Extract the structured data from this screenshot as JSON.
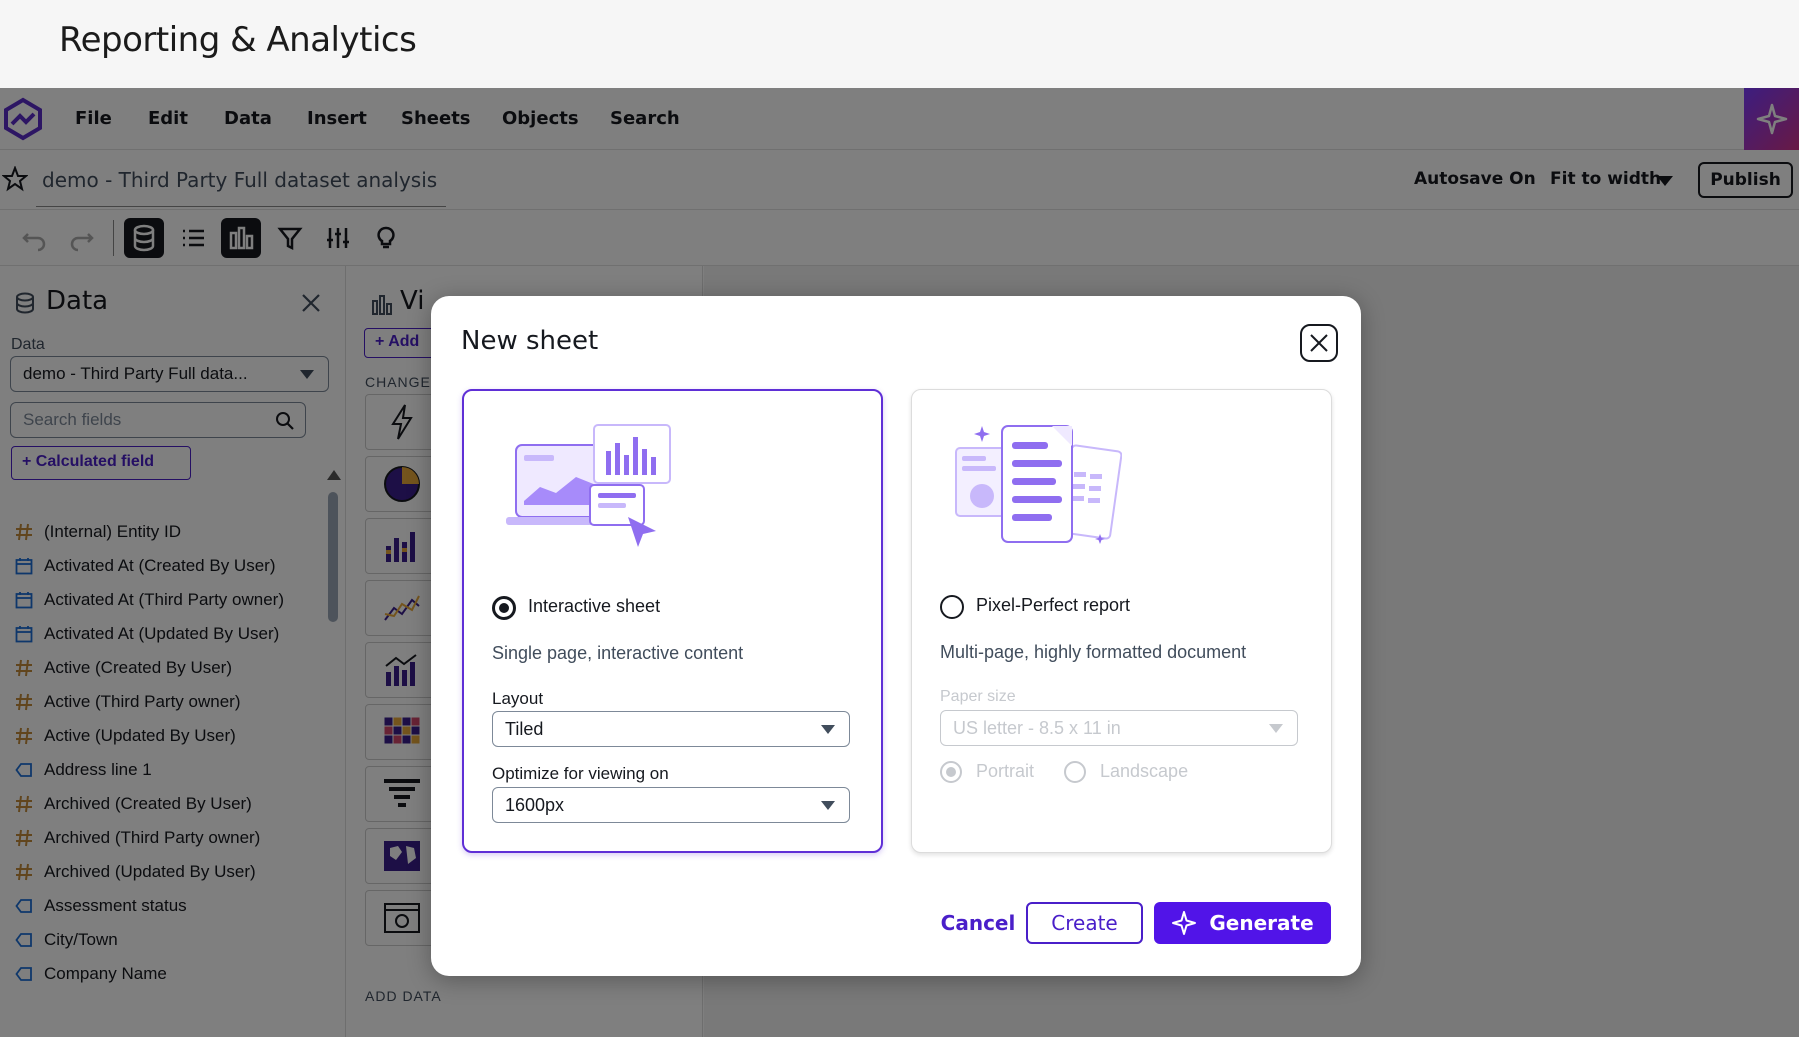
{
  "page": {
    "title": "Reporting & Analytics"
  },
  "menu": {
    "items": [
      "File",
      "Edit",
      "Data",
      "Insert",
      "Sheets",
      "Objects",
      "Search"
    ]
  },
  "titlebar": {
    "doc_title": "demo - Third Party Full dataset analysis",
    "autosave": "Autosave On",
    "fit_to_width": "Fit to width",
    "publish": "Publish"
  },
  "data_panel": {
    "title": "Data",
    "data_label": "Data",
    "dataset": "demo - Third Party Full data...",
    "search_placeholder": "Search fields",
    "calculated_field": "Calculated field",
    "fields": [
      {
        "label": "(Internal) Entity ID",
        "type": "number"
      },
      {
        "label": "Activated At (Created By User)",
        "type": "date"
      },
      {
        "label": "Activated At (Third Party owner)",
        "type": "date"
      },
      {
        "label": "Activated At (Updated By User)",
        "type": "date"
      },
      {
        "label": "Active (Created By User)",
        "type": "number"
      },
      {
        "label": "Active (Third Party owner)",
        "type": "number"
      },
      {
        "label": "Active (Updated By User)",
        "type": "number"
      },
      {
        "label": "Address line 1",
        "type": "text"
      },
      {
        "label": "Archived (Created By User)",
        "type": "number"
      },
      {
        "label": "Archived (Third Party owner)",
        "type": "number"
      },
      {
        "label": "Archived (Updated By User)",
        "type": "number"
      },
      {
        "label": "Assessment status",
        "type": "text"
      },
      {
        "label": "City/Town",
        "type": "text"
      },
      {
        "label": "Company Name",
        "type": "text"
      }
    ]
  },
  "vis_panel": {
    "title": "Vi",
    "add": "+ Add",
    "change": "CHANGE",
    "add_data": "ADD DATA"
  },
  "modal": {
    "title": "New sheet",
    "interactive": {
      "name": "Interactive sheet",
      "desc": "Single page, interactive content",
      "layout_label": "Layout",
      "layout_value": "Tiled",
      "optimize_label": "Optimize for viewing on",
      "optimize_value": "1600px"
    },
    "pixel": {
      "name": "Pixel-Perfect report",
      "desc": "Multi-page, highly formatted document",
      "paper_label": "Paper size",
      "paper_value": "US letter - 8.5 x 11 in",
      "portrait": "Portrait",
      "landscape": "Landscape"
    },
    "buttons": {
      "cancel": "Cancel",
      "create": "Create",
      "generate": "Generate"
    }
  },
  "colors": {
    "accent": "#5114e8",
    "primary_text": "#16191f",
    "overlay": "rgba(0,0,0,0.5)"
  }
}
